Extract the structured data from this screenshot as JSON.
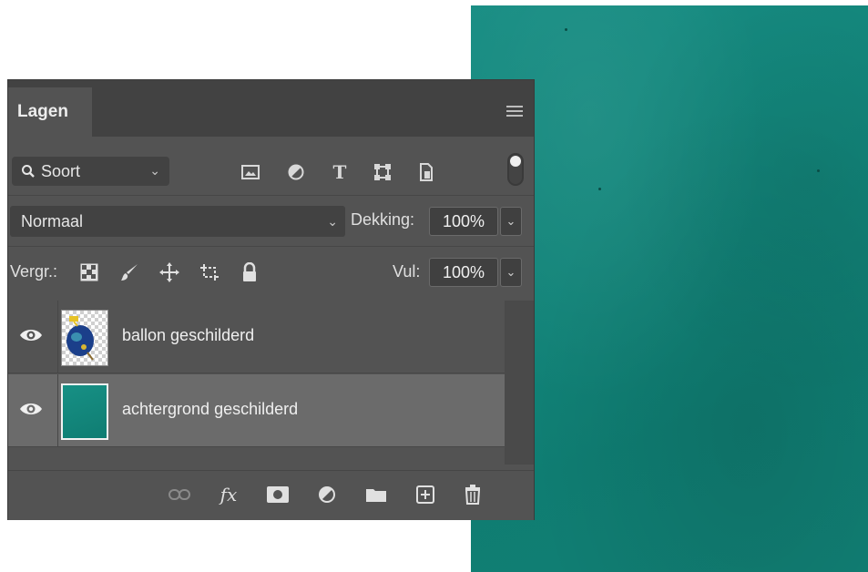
{
  "panel": {
    "tab_label": "Lagen",
    "filter": {
      "label": "Soort",
      "icons": [
        "image-filter-icon",
        "adjustment-filter-icon",
        "type-filter-icon",
        "shape-filter-icon",
        "smart-object-filter-icon"
      ]
    },
    "blend_mode": "Normaal",
    "opacity_label": "Dekking:",
    "opacity_value": "100%",
    "lock_label": "Vergr.:",
    "lock_icons": [
      "lock-transparent-pixels-icon",
      "lock-image-pixels-icon",
      "lock-position-icon",
      "lock-artboard-icon",
      "lock-all-icon"
    ],
    "fill_label": "Vul:",
    "fill_value": "100%"
  },
  "layers": [
    {
      "name": "ballon geschilderd",
      "visible": true,
      "selected": false,
      "thumbnail": "balloon-painting"
    },
    {
      "name": "achtergrond geschilderd",
      "visible": true,
      "selected": true,
      "thumbnail": "teal-background"
    }
  ],
  "footer_icons": [
    "link-layers-icon",
    "fx-icon",
    "add-mask-icon",
    "new-adjustment-layer-icon",
    "new-group-icon",
    "new-layer-icon",
    "delete-layer-icon"
  ],
  "colors": {
    "panel_bg": "#535353",
    "tab_bar_bg": "#424242",
    "selected_layer_bg": "#6b6b6b",
    "canvas_teal": "#12857a"
  }
}
